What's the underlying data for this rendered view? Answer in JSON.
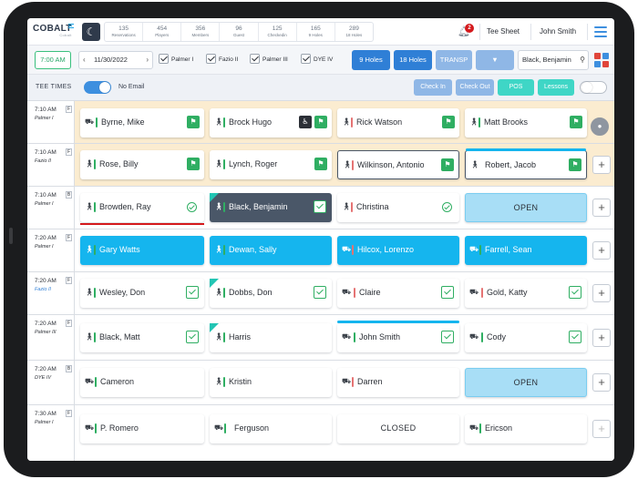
{
  "header": {
    "logo_text": "COBALT",
    "logo_sub": "Cobalt",
    "stats": [
      {
        "num": "135",
        "label": "Reservations"
      },
      {
        "num": "454",
        "label": "Players"
      },
      {
        "num": "356",
        "label": "Members"
      },
      {
        "num": "96",
        "label": "Guest"
      },
      {
        "num": "125",
        "label": "Checkedin"
      },
      {
        "num": "165",
        "label": "9 Holes"
      },
      {
        "num": "289",
        "label": "18 Holes"
      }
    ],
    "notification_count": "2",
    "tee_sheet_link": "Tee Sheet",
    "user_name": "John Smith"
  },
  "toolbar": {
    "time": "7:00 AM",
    "date": "11/30/2022",
    "courses": [
      "Palmer I",
      "Fazio II",
      "Palmer III",
      "DYE IV"
    ],
    "btn_9_holes": "9 Holes",
    "btn_18_holes": "18 Holes",
    "btn_transp": "TRANSP",
    "search_value": "Black, Benjamin"
  },
  "controls": {
    "tee_times_label": "TEE TIMES",
    "no_email_label": "No Email",
    "check_in": "Check In",
    "check_out": "Check Out",
    "pos": "POS",
    "lessons": "Lessons"
  },
  "colors": {
    "accent_blue": "#15b5ee",
    "primary_btn": "#2f7fd6",
    "green": "#2fae62",
    "slate": "#4a5768",
    "open_bg": "#a8def6",
    "highlight_row": "#fbecd0"
  },
  "rows": [
    {
      "time": "7:10 AM",
      "course": "Palmer I",
      "badge": "F",
      "slots": [
        {
          "name": "Byrne, Mike",
          "icon": "cart-icon",
          "bar": "green",
          "badge": "golf-flag"
        },
        {
          "name": "Brock Hugo",
          "icon": "walker-icon",
          "bar": "green",
          "badge": "golf-flag",
          "extra": "wheelchair"
        },
        {
          "name": "Rick Watson",
          "icon": "walker-icon",
          "bar": "red",
          "badge": "golf-flag"
        },
        {
          "name": "Matt Brooks",
          "icon": "walker-icon",
          "bar": "green",
          "badge": "golf-flag"
        }
      ]
    },
    {
      "time": "7:10 AM",
      "course": "Fazio II",
      "badge": "F",
      "slots": [
        {
          "name": "Rose, Billy",
          "icon": "walker-icon",
          "bar": "green",
          "badge": "golf-flag"
        },
        {
          "name": "Lynch, Roger",
          "icon": "walker-icon",
          "bar": "green",
          "badge": "golf-flag"
        },
        {
          "name": "Wilkinson, Antonio",
          "icon": "walker-icon",
          "bar": "red",
          "badge": "golf-flag"
        },
        {
          "name": "Robert, Jacob",
          "icon": "walker-icon",
          "bar": "none",
          "badge": "golf-flag"
        }
      ]
    },
    {
      "time": "7:10 AM",
      "course": "Palmer I",
      "badge": "B",
      "slots": [
        {
          "name": "Browden, Ray",
          "icon": "walker-icon",
          "bar": "green",
          "badge": "check"
        },
        {
          "name": "Black, Benjamin",
          "icon": "walker-icon",
          "bar": "green",
          "badge": "check"
        },
        {
          "name": "Christina",
          "icon": "walker-icon",
          "bar": "red",
          "badge": "check"
        },
        {
          "name": "OPEN"
        }
      ]
    },
    {
      "time": "7:20 AM",
      "course": "Palmer I",
      "badge": "F",
      "slots": [
        {
          "name": "Gary Watts",
          "icon": "walker-icon",
          "bar": "green"
        },
        {
          "name": "Dewan, Sally",
          "icon": "walker-icon",
          "bar": "green"
        },
        {
          "name": "Hilcox, Lorenzo",
          "icon": "cart-icon",
          "bar": "red"
        },
        {
          "name": "Farrell, Sean",
          "icon": "cart-icon",
          "bar": "green"
        }
      ]
    },
    {
      "time": "7:20 AM",
      "course": "Fazio II",
      "badge": "F",
      "slots": [
        {
          "name": "Wesley, Don",
          "icon": "walker-icon",
          "bar": "green",
          "badge": "check"
        },
        {
          "name": "Dobbs, Don",
          "icon": "walker-icon",
          "bar": "green",
          "badge": "check"
        },
        {
          "name": "Claire",
          "icon": "pushcart-icon",
          "bar": "red",
          "badge": "check"
        },
        {
          "name": "Gold, Katty",
          "icon": "pushcart-icon",
          "bar": "red",
          "badge": "check"
        }
      ]
    },
    {
      "time": "7:20 AM",
      "course": "Palmer III",
      "badge": "F",
      "slots": [
        {
          "name": "Black, Matt",
          "icon": "walker-icon",
          "bar": "green",
          "badge": "check"
        },
        {
          "name": "Harris",
          "icon": "walker-icon",
          "bar": "green"
        },
        {
          "name": "John Smith",
          "icon": "pushcart-icon",
          "bar": "green",
          "badge": "check"
        },
        {
          "name": "Cody",
          "icon": "pushcart-icon",
          "bar": "green",
          "badge": "check"
        }
      ]
    },
    {
      "time": "7:20 AM",
      "course": "DYE IV",
      "badge": "B",
      "slots": [
        {
          "name": "Cameron",
          "icon": "cart-icon",
          "bar": "green"
        },
        {
          "name": "Kristin",
          "icon": "walker-icon",
          "bar": "green"
        },
        {
          "name": "Darren",
          "icon": "cart-icon",
          "bar": "red"
        },
        {
          "name": "OPEN"
        }
      ]
    },
    {
      "time": "7:30 AM",
      "course": "Palmer I",
      "badge": "F",
      "slots": [
        {
          "name": "P. Romero",
          "icon": "cart-icon",
          "bar": "green"
        },
        {
          "name": "Ferguson",
          "icon": "cart-walker-icon",
          "bar": "green"
        },
        {
          "name": "CLOSED"
        },
        {
          "name": "Ericson",
          "icon": "cart-icon",
          "bar": "green"
        }
      ]
    }
  ]
}
